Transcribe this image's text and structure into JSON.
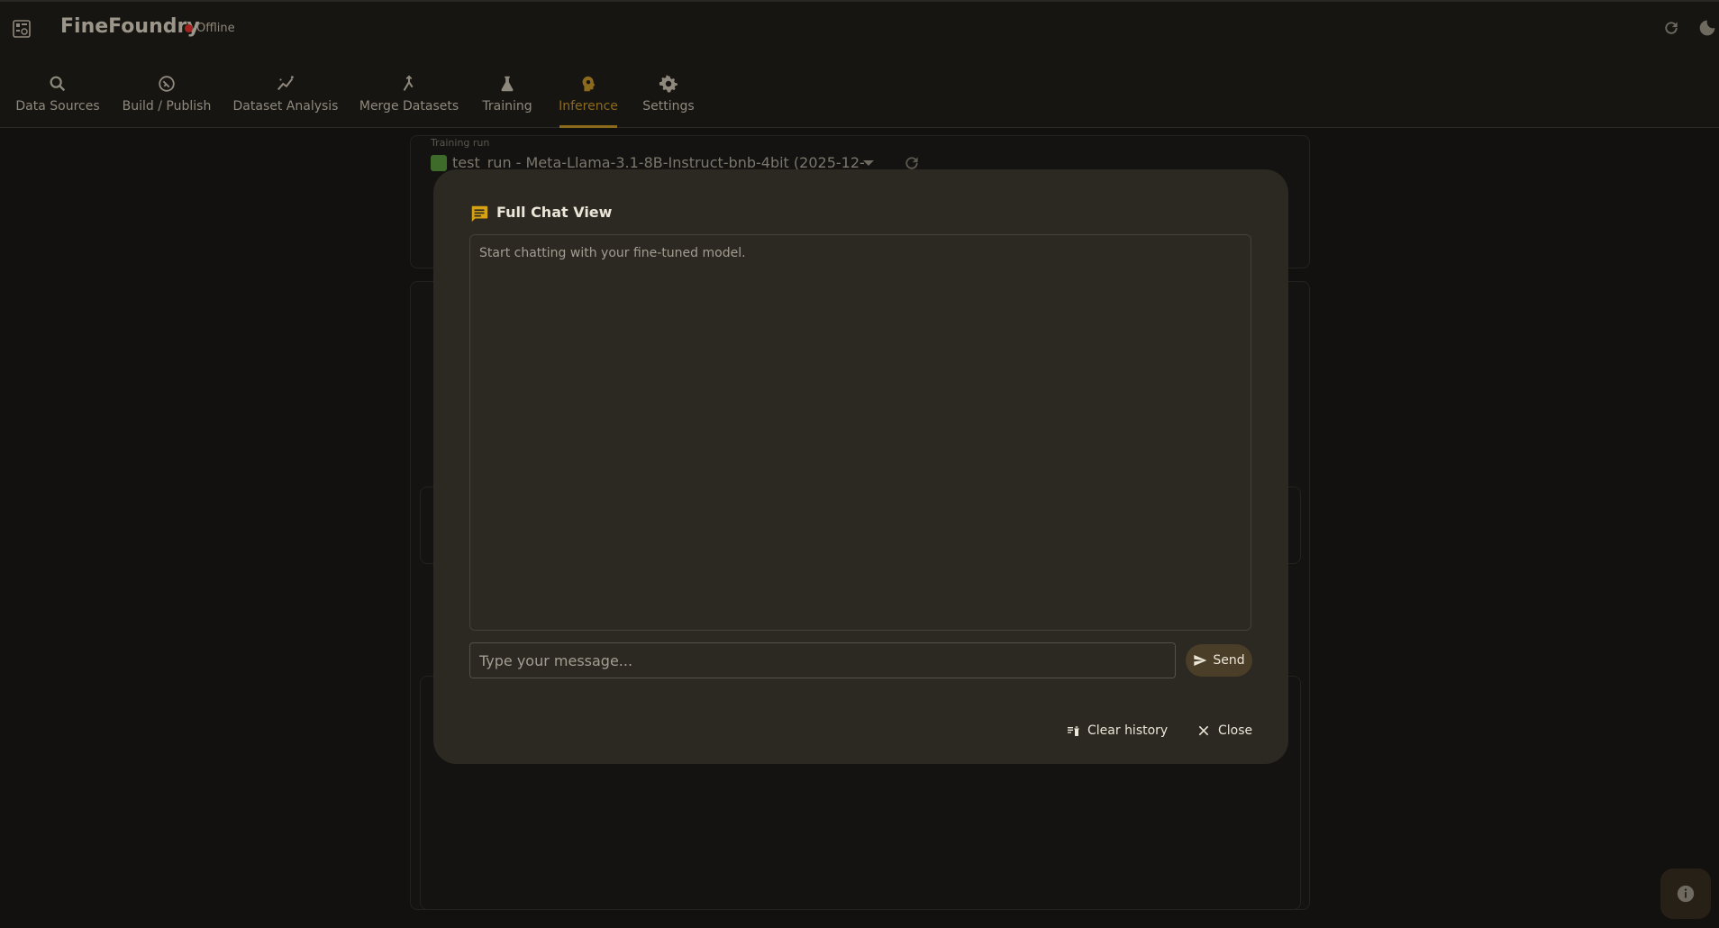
{
  "app": {
    "title": "FineFoundry",
    "status": "Offline",
    "colors": {
      "accent": "#8c6a1c",
      "offline": "#a3231f"
    }
  },
  "tabs": [
    {
      "label": "Data Sources",
      "icon": "search-icon"
    },
    {
      "label": "Build / Publish",
      "icon": "publish-icon"
    },
    {
      "label": "Dataset Analysis",
      "icon": "analytics-icon"
    },
    {
      "label": "Merge Datasets",
      "icon": "merge-icon"
    },
    {
      "label": "Training",
      "icon": "flask-icon"
    },
    {
      "label": "Inference",
      "icon": "psychology-icon",
      "active": true
    },
    {
      "label": "Settings",
      "icon": "gear-icon"
    }
  ],
  "background": {
    "training_run_label": "Training run",
    "training_run_value": "test_run - Meta-Llama-3.1-8B-Instruct-bnb-4bit (2025-12-"
  },
  "modal": {
    "title": "Full Chat View",
    "empty_text": "Start chatting with your fine-tuned model.",
    "input_placeholder": "Type your message...",
    "send_label": "Send",
    "clear_label": "Clear history",
    "close_label": "Close"
  }
}
